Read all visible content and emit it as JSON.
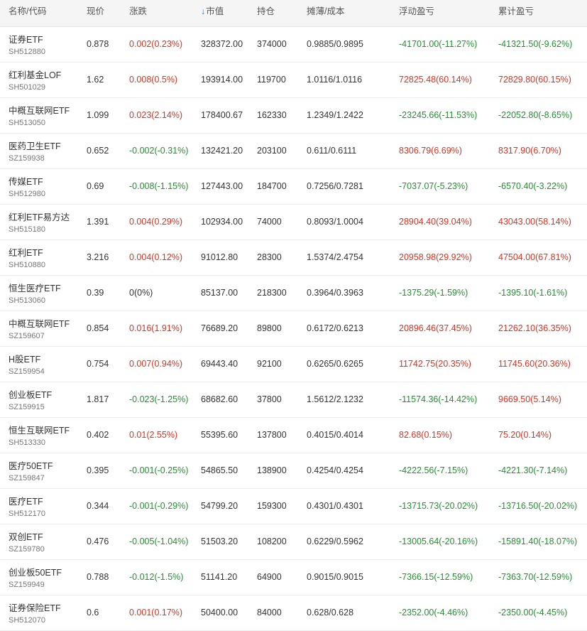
{
  "header": {
    "name_code": "名称/代码",
    "price": "现价",
    "change": "涨跌",
    "sort_arrow": "↓",
    "market_value": "市值",
    "holding": "持仓",
    "cost": "摊薄/成本",
    "float_pnl": "浮动盈亏",
    "cum_pnl": "累计盈亏"
  },
  "colors": {
    "up": "#e0301e",
    "down": "#22912f",
    "sort_arrow": "#2f7fd6"
  },
  "rows": [
    {
      "name": "证券ETF",
      "code": "SH512880",
      "price": "0.878",
      "change": "0.002(0.23%)",
      "change_dir": "up",
      "mv": "328372.00",
      "hold": "374000",
      "cost": "0.9885/0.9895",
      "float": "-41701.00(-11.27%)",
      "float_dir": "down",
      "cum": "-41321.50(-9.62%)",
      "cum_dir": "down"
    },
    {
      "name": "红利基金LOF",
      "code": "SH501029",
      "price": "1.62",
      "change": "0.008(0.5%)",
      "change_dir": "up",
      "mv": "193914.00",
      "hold": "119700",
      "cost": "1.0116/1.0116",
      "float": "72825.48(60.14%)",
      "float_dir": "up",
      "cum": "72829.80(60.15%)",
      "cum_dir": "up"
    },
    {
      "name": "中概互联网ETF",
      "code": "SH513050",
      "price": "1.099",
      "change": "0.023(2.14%)",
      "change_dir": "up",
      "mv": "178400.67",
      "hold": "162330",
      "cost": "1.2349/1.2422",
      "float": "-23245.66(-11.53%)",
      "float_dir": "down",
      "cum": "-22052.80(-8.65%)",
      "cum_dir": "down"
    },
    {
      "name": "医药卫生ETF",
      "code": "SZ159938",
      "price": "0.652",
      "change": "-0.002(-0.31%)",
      "change_dir": "down",
      "mv": "132421.20",
      "hold": "203100",
      "cost": "0.611/0.6111",
      "float": "8306.79(6.69%)",
      "float_dir": "up",
      "cum": "8317.90(6.70%)",
      "cum_dir": "up"
    },
    {
      "name": "传媒ETF",
      "code": "SH512980",
      "price": "0.69",
      "change": "-0.008(-1.15%)",
      "change_dir": "down",
      "mv": "127443.00",
      "hold": "184700",
      "cost": "0.7256/0.7281",
      "float": "-7037.07(-5.23%)",
      "float_dir": "down",
      "cum": "-6570.40(-3.22%)",
      "cum_dir": "down"
    },
    {
      "name": "红利ETF易方达",
      "code": "SH515180",
      "price": "1.391",
      "change": "0.004(0.29%)",
      "change_dir": "up",
      "mv": "102934.00",
      "hold": "74000",
      "cost": "0.8093/1.0004",
      "float": "28904.40(39.04%)",
      "float_dir": "up",
      "cum": "43043.00(58.14%)",
      "cum_dir": "up"
    },
    {
      "name": "红利ETF",
      "code": "SH510880",
      "price": "3.216",
      "change": "0.004(0.12%)",
      "change_dir": "up",
      "mv": "91012.80",
      "hold": "28300",
      "cost": "1.5374/2.4754",
      "float": "20958.98(29.92%)",
      "float_dir": "up",
      "cum": "47504.00(67.81%)",
      "cum_dir": "up"
    },
    {
      "name": "恒生医疗ETF",
      "code": "SH513060",
      "price": "0.39",
      "change": "0(0%)",
      "change_dir": "flat",
      "mv": "85137.00",
      "hold": "218300",
      "cost": "0.3964/0.3963",
      "float": "-1375.29(-1.59%)",
      "float_dir": "down",
      "cum": "-1395.10(-1.61%)",
      "cum_dir": "down"
    },
    {
      "name": "中概互联网ETF",
      "code": "SZ159607",
      "price": "0.854",
      "change": "0.016(1.91%)",
      "change_dir": "up",
      "mv": "76689.20",
      "hold": "89800",
      "cost": "0.6172/0.6213",
      "float": "20896.46(37.45%)",
      "float_dir": "up",
      "cum": "21262.10(36.35%)",
      "cum_dir": "up"
    },
    {
      "name": "H股ETF",
      "code": "SZ159954",
      "price": "0.754",
      "change": "0.007(0.94%)",
      "change_dir": "up",
      "mv": "69443.40",
      "hold": "92100",
      "cost": "0.6265/0.6265",
      "float": "11742.75(20.35%)",
      "float_dir": "up",
      "cum": "11745.60(20.36%)",
      "cum_dir": "up"
    },
    {
      "name": "创业板ETF",
      "code": "SZ159915",
      "price": "1.817",
      "change": "-0.023(-1.25%)",
      "change_dir": "down",
      "mv": "68682.60",
      "hold": "37800",
      "cost": "1.5612/2.1232",
      "float": "-11574.36(-14.42%)",
      "float_dir": "down",
      "cum": "9669.50(5.14%)",
      "cum_dir": "up"
    },
    {
      "name": "恒生互联网ETF",
      "code": "SH513330",
      "price": "0.402",
      "change": "0.01(2.55%)",
      "change_dir": "up",
      "mv": "55395.60",
      "hold": "137800",
      "cost": "0.4015/0.4014",
      "float": "82.68(0.15%)",
      "float_dir": "up",
      "cum": "75.20(0.14%)",
      "cum_dir": "up"
    },
    {
      "name": "医疗50ETF",
      "code": "SZ159847",
      "price": "0.395",
      "change": "-0.001(-0.25%)",
      "change_dir": "down",
      "mv": "54865.50",
      "hold": "138900",
      "cost": "0.4254/0.4254",
      "float": "-4222.56(-7.15%)",
      "float_dir": "down",
      "cum": "-4221.30(-7.14%)",
      "cum_dir": "down"
    },
    {
      "name": "医疗ETF",
      "code": "SH512170",
      "price": "0.344",
      "change": "-0.001(-0.29%)",
      "change_dir": "down",
      "mv": "54799.20",
      "hold": "159300",
      "cost": "0.4301/0.4301",
      "float": "-13715.73(-20.02%)",
      "float_dir": "down",
      "cum": "-13716.50(-20.02%)",
      "cum_dir": "down"
    },
    {
      "name": "双创ETF",
      "code": "SZ159780",
      "price": "0.476",
      "change": "-0.005(-1.04%)",
      "change_dir": "down",
      "mv": "51503.20",
      "hold": "108200",
      "cost": "0.6229/0.5962",
      "float": "-13005.64(-20.16%)",
      "float_dir": "down",
      "cum": "-15891.40(-18.07%)",
      "cum_dir": "down"
    },
    {
      "name": "创业板50ETF",
      "code": "SZ159949",
      "price": "0.788",
      "change": "-0.012(-1.5%)",
      "change_dir": "down",
      "mv": "51141.20",
      "hold": "64900",
      "cost": "0.9015/0.9015",
      "float": "-7366.15(-12.59%)",
      "float_dir": "down",
      "cum": "-7363.70(-12.59%)",
      "cum_dir": "down"
    },
    {
      "name": "证券保险ETF",
      "code": "SH512070",
      "price": "0.6",
      "change": "0.001(0.17%)",
      "change_dir": "up",
      "mv": "50400.00",
      "hold": "84000",
      "cost": "0.628/0.628",
      "float": "-2352.00(-4.46%)",
      "float_dir": "down",
      "cum": "-2350.00(-4.45%)",
      "cum_dir": "down"
    }
  ]
}
